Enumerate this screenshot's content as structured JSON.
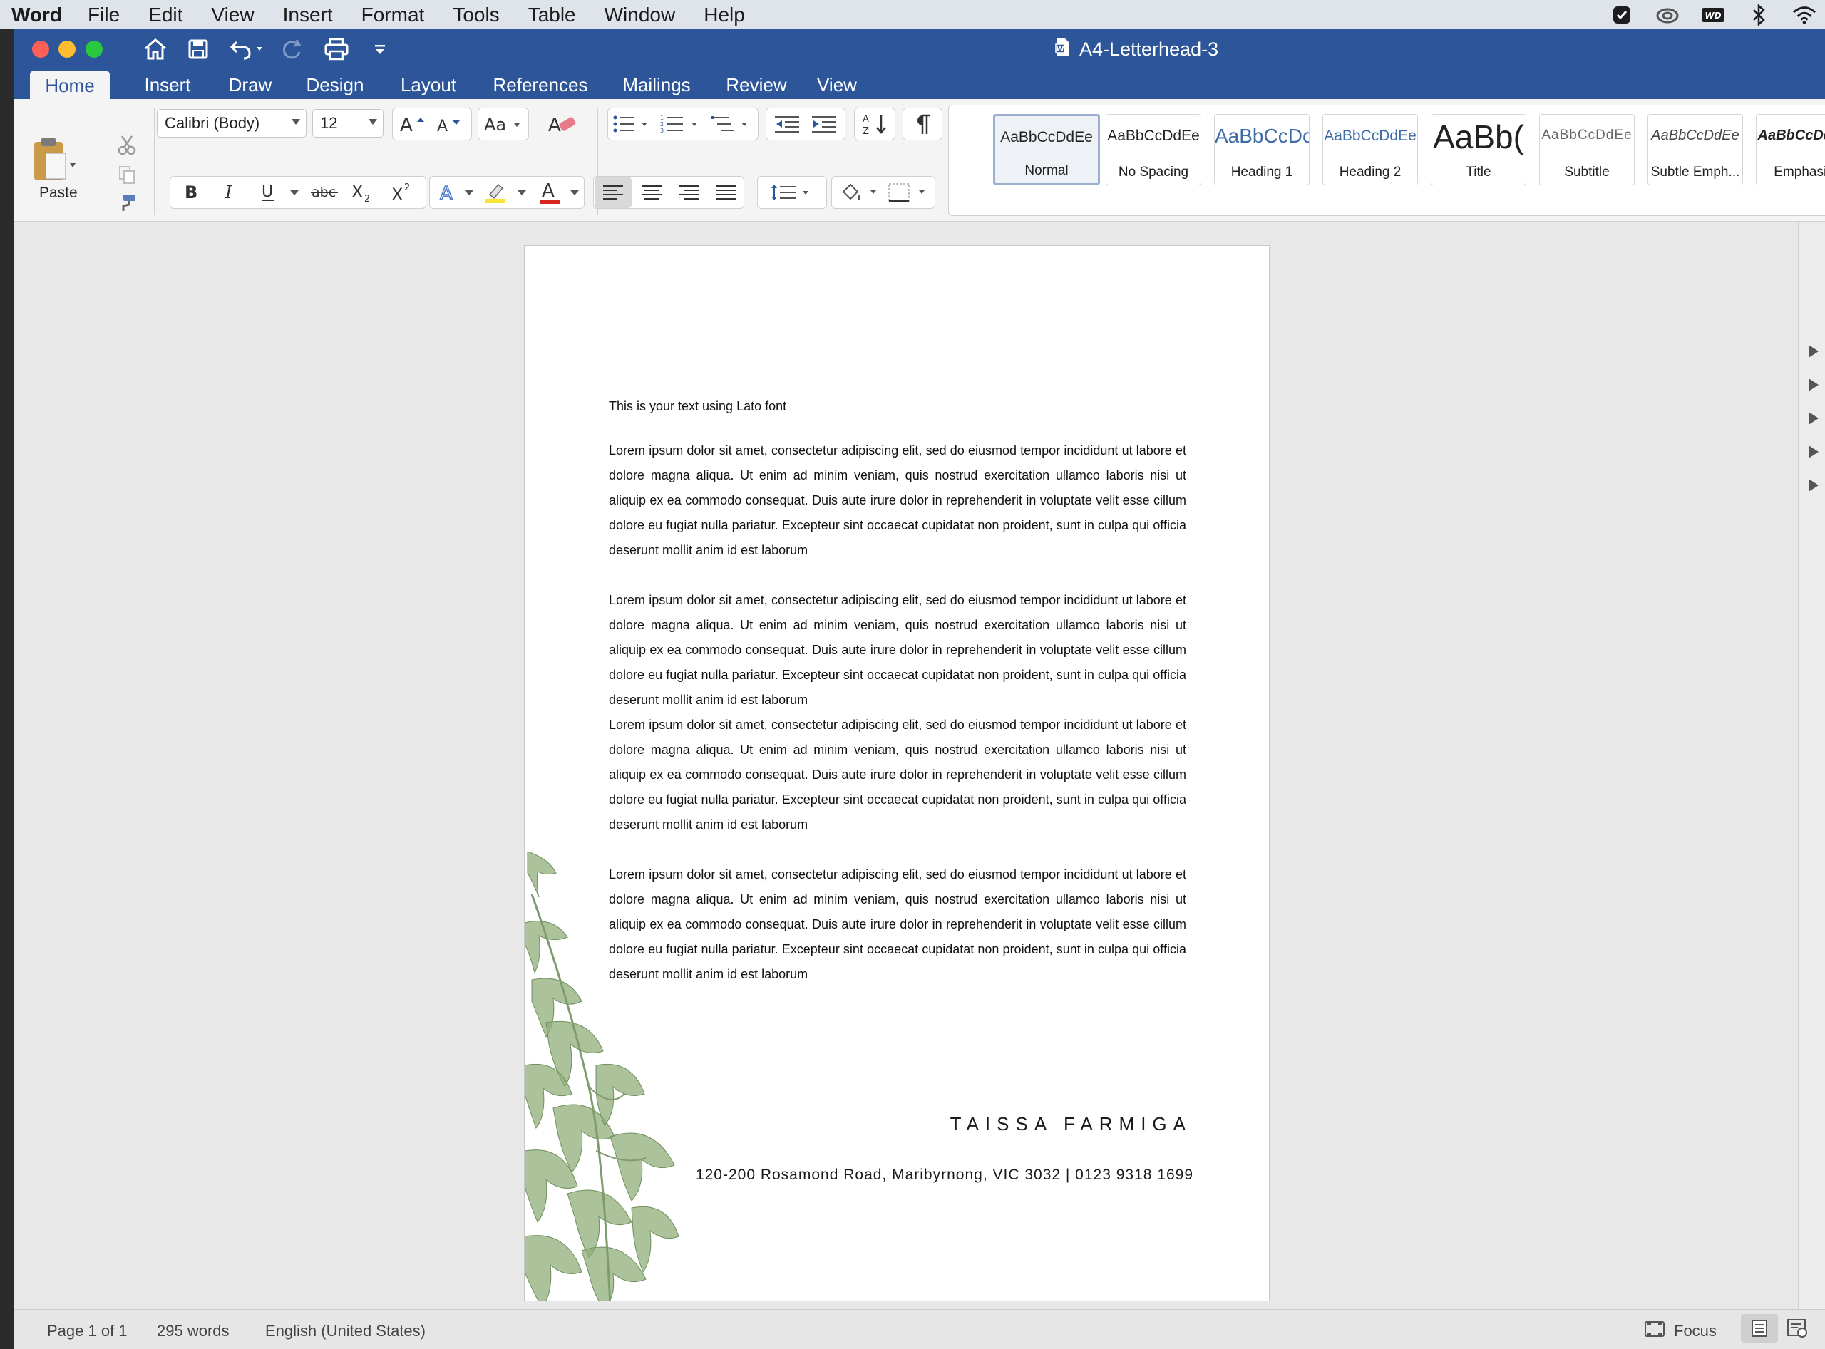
{
  "menubar": {
    "app_name": "Word",
    "items": [
      "File",
      "Edit",
      "View",
      "Insert",
      "Format",
      "Tools",
      "Table",
      "Window",
      "Help"
    ]
  },
  "window": {
    "title": "A4-Letterhead-3"
  },
  "ribbon_tabs": [
    "Home",
    "Insert",
    "Draw",
    "Design",
    "Layout",
    "References",
    "Mailings",
    "Review",
    "View"
  ],
  "ribbon": {
    "paste_label": "Paste",
    "font_name": "Calibri (Body)",
    "font_size": "12",
    "styles": [
      {
        "sample": "AaBbCcDdEe",
        "name": "Normal"
      },
      {
        "sample": "AaBbCcDdEe",
        "name": "No Spacing"
      },
      {
        "sample": "AaBbCcDc",
        "name": "Heading 1"
      },
      {
        "sample": "AaBbCcDdEe",
        "name": "Heading 2"
      },
      {
        "sample": "AaBb(",
        "name": "Title"
      },
      {
        "sample": "AaBbCcDdEe",
        "name": "Subtitle"
      },
      {
        "sample": "AaBbCcDdEe",
        "name": "Subtle Emph..."
      },
      {
        "sample": "AaBbCcDdEe",
        "name": "Emphasis"
      }
    ]
  },
  "document": {
    "intro": "This is your text using Lato font",
    "paragraphs": [
      "Lorem ipsum dolor sit amet, consectetur adipiscing elit, sed do eiusmod tempor incididunt ut labore et dolore magna aliqua. Ut enim ad minim veniam, quis nostrud exercitation ullamco laboris nisi ut aliquip ex ea commodo consequat. Duis aute irure dolor in reprehenderit in voluptate velit esse cillum dolore eu fugiat nulla pariatur. Excepteur sint occaecat cupidatat non proident, sunt in culpa qui officia deserunt mollit anim id est laborum",
      "Lorem ipsum dolor sit amet, consectetur adipiscing elit, sed do eiusmod tempor incididunt ut labore et dolore magna aliqua. Ut enim ad minim veniam, quis nostrud exercitation ullamco laboris nisi ut aliquip ex ea commodo consequat. Duis aute irure dolor in reprehenderit in voluptate velit esse cillum dolore eu fugiat nulla pariatur. Excepteur sint occaecat cupidatat non proident, sunt in culpa qui officia deserunt mollit anim id est laborum",
      "Lorem ipsum dolor sit amet, consectetur adipiscing elit, sed do eiusmod tempor incididunt ut labore et dolore magna aliqua. Ut enim ad minim veniam, quis nostrud exercitation ullamco laboris nisi ut aliquip ex ea commodo consequat. Duis aute irure dolor in reprehenderit in voluptate velit esse cillum dolore eu fugiat nulla pariatur. Excepteur sint occaecat cupidatat non proident, sunt in culpa qui officia deserunt mollit anim id est laborum",
      "Lorem ipsum dolor sit amet, consectetur adipiscing elit, sed do eiusmod tempor incididunt ut labore et dolore magna aliqua. Ut enim ad minim veniam, quis nostrud exercitation ullamco laboris nisi ut aliquip ex ea commodo consequat. Duis aute irure dolor in reprehenderit in voluptate velit esse cillum dolore eu fugiat nulla pariatur. Excepteur sint occaecat cupidatat non proident, sunt in culpa qui officia deserunt mollit anim id est laborum"
    ],
    "signature_name": "TAISSA FARMIGA",
    "signature_address": "120-200 Rosamond Road, Maribyrnong, VIC 3032  | 0123 9318 1699"
  },
  "statusbar": {
    "page": "Page 1 of 1",
    "words": "295 words",
    "language": "English (United States)",
    "focus_label": "Focus"
  },
  "colors": {
    "titlebar": "#2c5699",
    "ribbon_bg": "#f4f4f4",
    "foliage": "#8fae7a"
  },
  "icons": {
    "titlebar": [
      "home-icon",
      "save-icon",
      "undo-icon",
      "redo-icon",
      "print-icon",
      "customize-toolbar-icon"
    ],
    "status": [
      "checkmark-app-icon",
      "creative-cloud-icon",
      "wd-drive-icon",
      "bluetooth-icon",
      "wifi-icon"
    ]
  }
}
